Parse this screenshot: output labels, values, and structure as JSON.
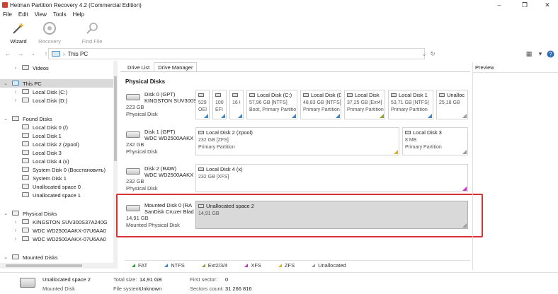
{
  "window": {
    "title": "Hetman Partition Recovery 4.2 (Commercial Edition)",
    "controls": [
      "–",
      "❐",
      "✕"
    ]
  },
  "menu": [
    "File",
    "Edit",
    "View",
    "Tools",
    "Help"
  ],
  "toolbar": {
    "wizard": "Wizard",
    "recovery": "Recovery",
    "find_file": "Find File"
  },
  "address": {
    "path": "This PC"
  },
  "sidebar": {
    "items": [
      {
        "label": "Videos",
        "indent": 2,
        "chev": "›"
      },
      {
        "label": "This PC",
        "indent": 1,
        "chev": "⌄",
        "selected": true
      },
      {
        "label": "Local Disk (C:)",
        "indent": 2,
        "chev": "›"
      },
      {
        "label": "Local Disk (D:)",
        "indent": 2,
        "chev": "›"
      },
      {
        "label": "Found Disks",
        "indent": 1,
        "chev": "⌄"
      },
      {
        "label": "Local Disk 0 (/)",
        "indent": 2,
        "chev": ""
      },
      {
        "label": "Local Disk 1",
        "indent": 2,
        "chev": ""
      },
      {
        "label": "Local Disk 2 (zpool)",
        "indent": 2,
        "chev": ""
      },
      {
        "label": "Local Disk 3",
        "indent": 2,
        "chev": ""
      },
      {
        "label": "Local Disk 4 (x)",
        "indent": 2,
        "chev": ""
      },
      {
        "label": "System Disk 0 (Восстановить)",
        "indent": 2,
        "chev": ""
      },
      {
        "label": "System Disk 1",
        "indent": 2,
        "chev": ""
      },
      {
        "label": "Unallocated space 0",
        "indent": 2,
        "chev": ""
      },
      {
        "label": "Unallocated space 1",
        "indent": 2,
        "chev": ""
      },
      {
        "label": "Physical Disks",
        "indent": 1,
        "chev": "⌄"
      },
      {
        "label": "KINGSTON SUV300S37A240G",
        "indent": 2,
        "chev": "›"
      },
      {
        "label": "WDC WD2500AAKX-07U6AA0",
        "indent": 2,
        "chev": "›"
      },
      {
        "label": "WDC WD2500AAKX-07U6AA0",
        "indent": 2,
        "chev": "›"
      },
      {
        "label": "Mounted Disks",
        "indent": 1,
        "chev": "⌄"
      }
    ]
  },
  "tabs": [
    "Drive List",
    "Drive Manager"
  ],
  "section_title": "Physical Disks",
  "preview_title": "Preview",
  "disks": [
    {
      "name1": "Disk 0 (GPT)",
      "name2": "KINGSTON SUV300S",
      "size": "223 GB",
      "type": "Physical Disk",
      "parts": [
        {
          "name": "",
          "l2": "529",
          "l3": "OEI"
        },
        {
          "name": "",
          "l2": "100",
          "l3": "EFI"
        },
        {
          "name": "",
          "l2": "16 I",
          "l3": ""
        },
        {
          "name": "Local Disk (C:)",
          "l2": "57,96 GB [NTFS]",
          "l3": "Boot, Primary Partitio"
        },
        {
          "name": "Local Disk (D",
          "l2": "48,83 GB [NTFS]",
          "l3": "Primary Partition"
        },
        {
          "name": "Local Disk",
          "l2": "37,25 GB [Ext4]",
          "l3": "Primary Partition"
        },
        {
          "name": "Local Disk 1",
          "l2": "53,71 GB [NTFS]",
          "l3": "Primary Partition"
        },
        {
          "name": "Unalloc",
          "l2": "25,18 GB",
          "l3": ""
        }
      ]
    },
    {
      "name1": "Disk 1 (GPT)",
      "name2": "WDC WD2500AAKX",
      "size": "232 GB",
      "type": "Physical Disk",
      "parts": [
        {
          "name": "Local Disk 2 (zpool)",
          "l2": "232 GB [ZFS]",
          "l3": "Primary Partition"
        },
        {
          "name": "Local Disk 3",
          "l2": "8 MB",
          "l3": "Primary Partition"
        }
      ]
    },
    {
      "name1": "Disk 2 (RAW)",
      "name2": "WDC WD2500AAKX",
      "size": "232 GB",
      "type": "Physical Disk",
      "parts": [
        {
          "name": "Local Disk 4 (x)",
          "l2": "232 GB [XFS]",
          "l3": ""
        }
      ]
    },
    {
      "name1": "Mounted Disk 0 (RA",
      "name2": "SanDisk Cruzer Blad",
      "size": "14,91 GB",
      "type": "Mounted Physical Disk",
      "parts": [
        {
          "name": "Unallocated space 2",
          "l2": "14,91 GB",
          "l3": ""
        }
      ]
    }
  ],
  "legend": [
    {
      "label": "FAT",
      "color": "#3a9a3a"
    },
    {
      "label": "NTFS",
      "color": "#3c86c9"
    },
    {
      "label": "Ext2/3/4",
      "color": "#8aa62c"
    },
    {
      "label": "XFS",
      "color": "#cc33cc"
    },
    {
      "label": "ZFS",
      "color": "#e0b020"
    },
    {
      "label": "Unallocated",
      "color": "#9a9a9a"
    }
  ],
  "status": {
    "name": "Unallocated space 2",
    "type": "Mounted Disk",
    "total_size_label": "Total size:",
    "total_size": "14,91 GB",
    "file_system_label": "File system:",
    "file_system": "Unknown",
    "first_sector_label": "First sector:",
    "first_sector": "0",
    "sectors_count_label": "Sectors count:",
    "sectors_count": "31 266 816"
  }
}
